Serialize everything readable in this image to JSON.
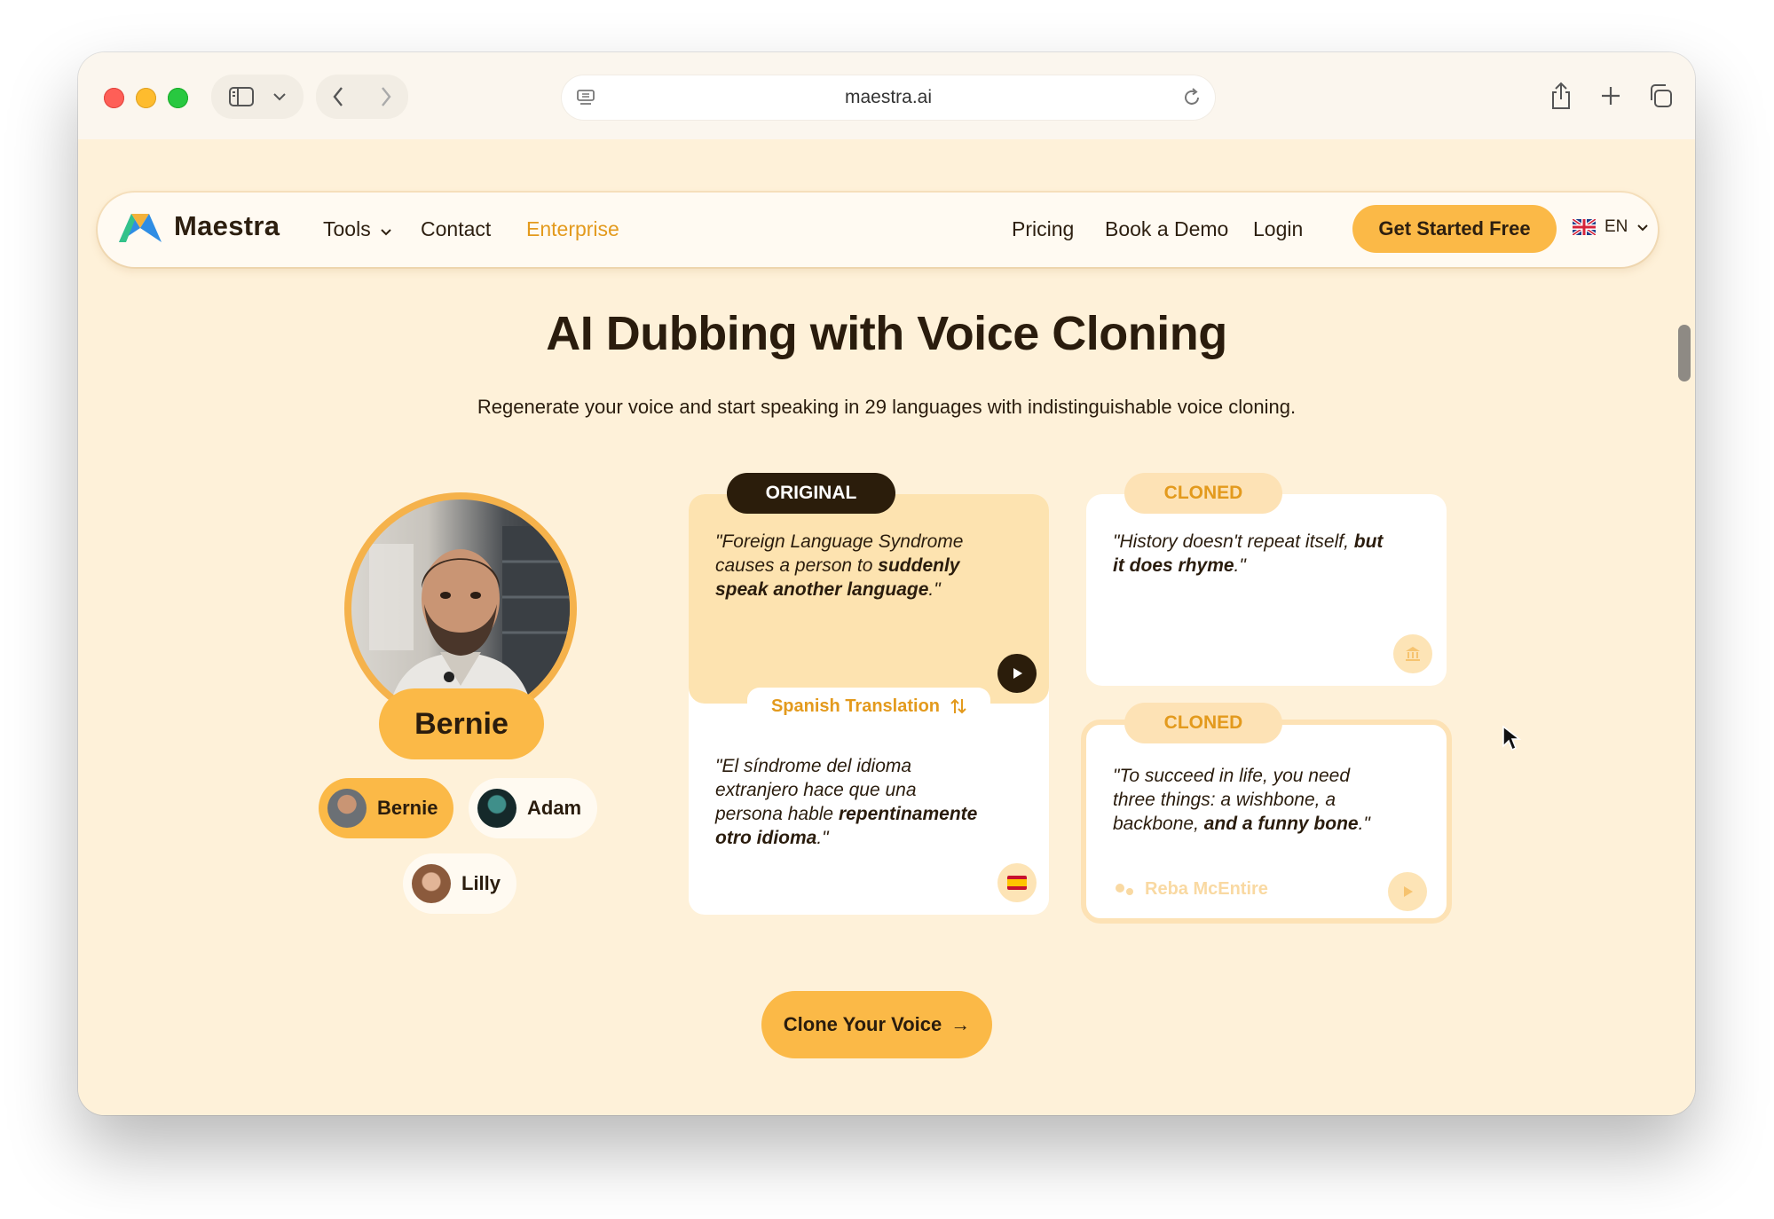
{
  "browser": {
    "url": "maestra.ai"
  },
  "nav": {
    "brand": "Maestra",
    "tools": "Tools",
    "contact": "Contact",
    "enterprise": "Enterprise",
    "pricing": "Pricing",
    "book_demo": "Book a Demo",
    "login": "Login",
    "cta": "Get Started Free",
    "lang": "EN",
    "accent_color": "#fbb947"
  },
  "hero": {
    "title": "AI Dubbing with Voice Cloning",
    "subtitle": "Regenerate your voice and start speaking in 29 languages with indistinguishable voice cloning."
  },
  "speaker": {
    "name": "Bernie",
    "voices": [
      "Bernie",
      "Adam",
      "Lilly"
    ],
    "selected": "Bernie"
  },
  "original": {
    "tag": "ORIGINAL",
    "quote_a": "\"Foreign Language Syndrome causes a person to ",
    "quote_b": "suddenly speak another language",
    "quote_c": ".\"",
    "translation_label": "Spanish Translation",
    "translation_a": "\"El síndrome del idioma extranjero hace que una persona hable ",
    "translation_b": "repentinamente otro idioma",
    "translation_c": ".\""
  },
  "cloned_1": {
    "tag": "CLONED",
    "quote_a": "\"History doesn't repeat itself, ",
    "quote_b": "but it does rhyme",
    "quote_c": ".\""
  },
  "cloned_2": {
    "tag": "CLONED",
    "quote_a": "\"To succeed in life, you need three things: a wishbone, a backbone, ",
    "quote_b": "and a funny bone",
    "quote_c": ".\"",
    "author": "Reba McEntire"
  },
  "actions": {
    "clone_button": "Clone Your Voice",
    "clone_arrow": "→"
  }
}
